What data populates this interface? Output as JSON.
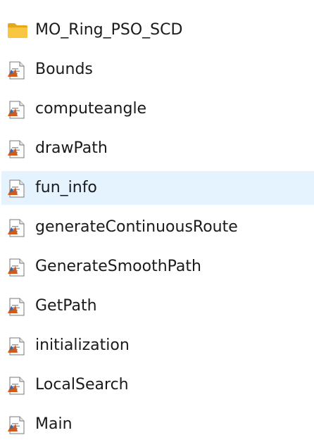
{
  "items": [
    {
      "label": "MO_Ring_PSO_SCD",
      "icon": "folder-icon",
      "selected": false
    },
    {
      "label": "Bounds",
      "icon": "matlab-file-icon",
      "selected": false
    },
    {
      "label": "computeangle",
      "icon": "matlab-file-icon",
      "selected": false
    },
    {
      "label": "drawPath",
      "icon": "matlab-file-icon",
      "selected": false
    },
    {
      "label": "fun_info",
      "icon": "matlab-file-icon",
      "selected": true
    },
    {
      "label": "generateContinuousRoute",
      "icon": "matlab-file-icon",
      "selected": false
    },
    {
      "label": "GenerateSmoothPath",
      "icon": "matlab-file-icon",
      "selected": false
    },
    {
      "label": "GetPath",
      "icon": "matlab-file-icon",
      "selected": false
    },
    {
      "label": "initialization",
      "icon": "matlab-file-icon",
      "selected": false
    },
    {
      "label": "LocalSearch",
      "icon": "matlab-file-icon",
      "selected": false
    },
    {
      "label": "Main",
      "icon": "matlab-file-icon",
      "selected": false
    }
  ],
  "colors": {
    "selection": "#e5f3ff",
    "folder": "#f5c33b",
    "text": "#1a1a1a"
  }
}
